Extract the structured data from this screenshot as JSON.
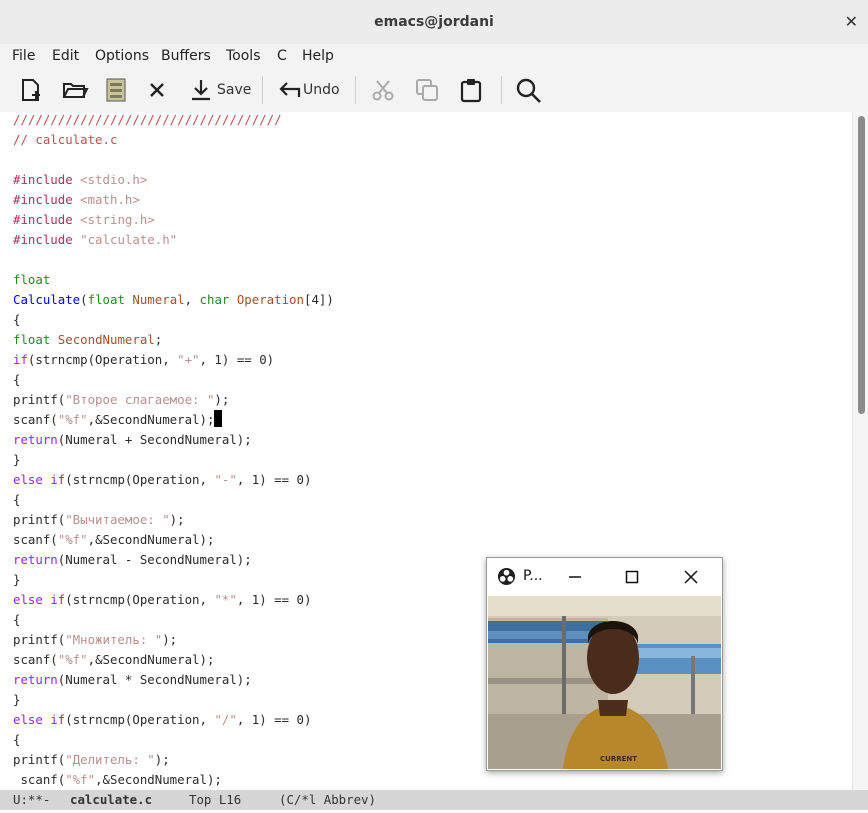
{
  "window": {
    "title": "emacs@jordani",
    "close_symbol": "✕"
  },
  "menu": [
    "File",
    "Edit",
    "Options",
    "Buffers",
    "Tools",
    "C",
    "Help"
  ],
  "toolbar": {
    "icons": [
      "new-file-icon",
      "open-folder-icon",
      "save-as-icon",
      "close-icon",
      "download-save-icon",
      "undo-icon",
      "cut-icon",
      "copy-icon",
      "paste-icon",
      "search-icon"
    ],
    "save_label": "Save",
    "undo_label": "Undo"
  },
  "colors": {
    "comment": "#c0504d",
    "keyword": "#a020f0",
    "type": "#228b22",
    "function": "#0000ff",
    "variable": "#a0522d",
    "string": "#bc8f8f",
    "preprocessor": "#b0305a"
  },
  "code": [
    [
      {
        "t": "////////////////////////////////////",
        "c": "comment"
      }
    ],
    [
      {
        "t": "// calculate.c",
        "c": "comment"
      }
    ],
    [],
    [
      {
        "t": "#include ",
        "c": "preprocessor"
      },
      {
        "t": "<stdio.h>",
        "c": "string"
      }
    ],
    [
      {
        "t": "#include ",
        "c": "preprocessor"
      },
      {
        "t": "<math.h>",
        "c": "string"
      }
    ],
    [
      {
        "t": "#include ",
        "c": "preprocessor"
      },
      {
        "t": "<string.h>",
        "c": "string"
      }
    ],
    [
      {
        "t": "#include ",
        "c": "preprocessor"
      },
      {
        "t": "\"calculate.h\"",
        "c": "string"
      }
    ],
    [],
    [
      {
        "t": "float",
        "c": "type"
      }
    ],
    [
      {
        "t": "Calculate",
        "c": "function"
      },
      {
        "t": "("
      },
      {
        "t": "float",
        "c": "type"
      },
      {
        "t": " "
      },
      {
        "t": "Numeral",
        "c": "variable"
      },
      {
        "t": ", "
      },
      {
        "t": "char",
        "c": "type"
      },
      {
        "t": " "
      },
      {
        "t": "Operation",
        "c": "variable"
      },
      {
        "t": "[4])"
      }
    ],
    [
      {
        "t": "{"
      }
    ],
    [
      {
        "t": "float",
        "c": "type"
      },
      {
        "t": " "
      },
      {
        "t": "SecondNumeral",
        "c": "variable"
      },
      {
        "t": ";"
      }
    ],
    [
      {
        "t": "if",
        "c": "keyword"
      },
      {
        "t": "(strncmp(Operation, "
      },
      {
        "t": "\"+\"",
        "c": "string"
      },
      {
        "t": ", 1) == 0)"
      }
    ],
    [
      {
        "t": "{"
      }
    ],
    [
      {
        "t": "printf("
      },
      {
        "t": "\"Второе слагаемое: \"",
        "c": "string"
      },
      {
        "t": ");"
      }
    ],
    [
      {
        "t": "scanf("
      },
      {
        "t": "\"%f\"",
        "c": "string"
      },
      {
        "t": ",&SecondNumeral);"
      },
      {
        "cursor": true
      }
    ],
    [
      {
        "t": "return",
        "c": "keyword"
      },
      {
        "t": "(Numeral + SecondNumeral);"
      }
    ],
    [
      {
        "t": "}"
      }
    ],
    [
      {
        "t": "else",
        "c": "keyword"
      },
      {
        "t": " "
      },
      {
        "t": "if",
        "c": "keyword"
      },
      {
        "t": "(strncmp(Operation, "
      },
      {
        "t": "\"-\"",
        "c": "string"
      },
      {
        "t": ", 1) == 0)"
      }
    ],
    [
      {
        "t": "{"
      }
    ],
    [
      {
        "t": "printf("
      },
      {
        "t": "\"Вычитаемое: \"",
        "c": "string"
      },
      {
        "t": ");"
      }
    ],
    [
      {
        "t": "scanf("
      },
      {
        "t": "\"%f\"",
        "c": "string"
      },
      {
        "t": ",&SecondNumeral);"
      }
    ],
    [
      {
        "t": "return",
        "c": "keyword"
      },
      {
        "t": "(Numeral - SecondNumeral);"
      }
    ],
    [
      {
        "t": "}"
      }
    ],
    [
      {
        "t": "else",
        "c": "keyword"
      },
      {
        "t": " "
      },
      {
        "t": "if",
        "c": "keyword"
      },
      {
        "t": "(strncmp(Operation, "
      },
      {
        "t": "\"*\"",
        "c": "string"
      },
      {
        "t": ", 1) == 0)"
      }
    ],
    [
      {
        "t": "{"
      }
    ],
    [
      {
        "t": "printf("
      },
      {
        "t": "\"Множитель: \"",
        "c": "string"
      },
      {
        "t": ");"
      }
    ],
    [
      {
        "t": "scanf("
      },
      {
        "t": "\"%f\"",
        "c": "string"
      },
      {
        "t": ",&SecondNumeral);"
      }
    ],
    [
      {
        "t": "return",
        "c": "keyword"
      },
      {
        "t": "(Numeral * SecondNumeral);"
      }
    ],
    [
      {
        "t": "}"
      }
    ],
    [
      {
        "t": "else",
        "c": "keyword"
      },
      {
        "t": " "
      },
      {
        "t": "if",
        "c": "keyword"
      },
      {
        "t": "(strncmp(Operation, "
      },
      {
        "t": "\"/\"",
        "c": "string"
      },
      {
        "t": ", 1) == 0)"
      }
    ],
    [
      {
        "t": "{"
      }
    ],
    [
      {
        "t": "printf("
      },
      {
        "t": "\"Делитель: \"",
        "c": "string"
      },
      {
        "t": ");"
      }
    ],
    [
      {
        "t": " scanf("
      },
      {
        "t": "\"%f\"",
        "c": "string"
      },
      {
        "t": ",&SecondNumeral);"
      }
    ]
  ],
  "modeline": {
    "state": "U:**-",
    "buffer": "calculate.c",
    "position": "Top L16",
    "mode": "(C/*l Abbrev)"
  },
  "popup": {
    "title": "P...",
    "app_icon": "obs-icon",
    "controls": [
      "minimize-icon",
      "maximize-icon",
      "close-icon"
    ]
  }
}
